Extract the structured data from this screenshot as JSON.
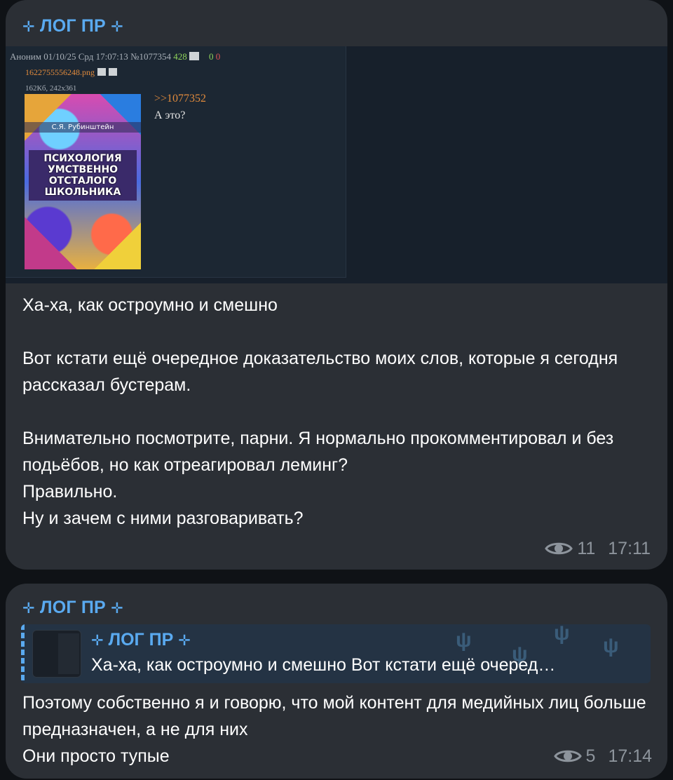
{
  "messages": [
    {
      "author_cross": "✛",
      "author": "ЛОГ ПР",
      "screenshot": {
        "header": {
          "name": "Аноним",
          "date": "01/10/25 Срд 17:07:13",
          "number": "№1077354",
          "replies": "428",
          "likes": "0",
          "dislikes": "0"
        },
        "file_name": "1622755556248.png",
        "file_info": "162Кб, 242x361",
        "book_author": "С.Я. Рубинштейн",
        "book_title_lines": [
          "ПСИХОЛОГИЯ",
          "УМСТВЕННО",
          "ОТСТАЛОГО",
          "ШКОЛЬНИКА"
        ],
        "reply_link": ">>1077352",
        "post_text": "А это?"
      },
      "text": "Ха-ха, как остроумно и смешно\n\nВот кстати ещё очередное доказательство моих слов, которые я сегодня рассказал бустерам.\n\nВнимательно посмотрите, парни. Я нормально прокомментировал и без подьёбов, но как отреагировал леминг?\nПравильно.\nНу и зачем с ними разговаривать?",
      "views": "11",
      "time": "17:11"
    },
    {
      "author_cross": "✛",
      "author": "ЛОГ ПР",
      "reply": {
        "author": "ЛОГ ПР",
        "text": "Ха-ха, как остроумно и смешно  Вот кстати ещё очеред…"
      },
      "text": "Поэтому собственно я и говорю, что мой контент для медийных лиц больше предназначен, а не для них\nОни просто тупые",
      "views": "5",
      "time": "17:14"
    }
  ],
  "colors": {
    "background": "#0f1216",
    "bubble": "#2b2f35",
    "author": "#5aaaf0",
    "meta": "#8d949c",
    "reply_bg": "#243344"
  },
  "icons": {
    "views": "eye-icon",
    "author_decoration": "cross-icon"
  }
}
